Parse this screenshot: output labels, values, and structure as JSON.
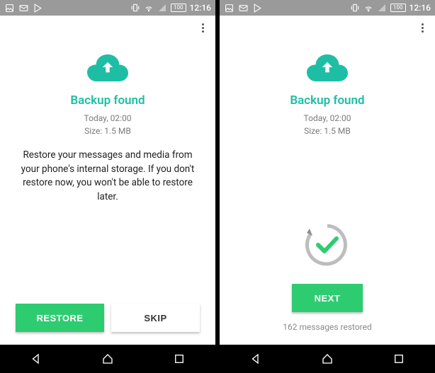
{
  "status": {
    "time": "12:16",
    "battery": "100"
  },
  "screen1": {
    "title": "Backup found",
    "timestamp": "Today, 02:00",
    "size": "Size: 1.5 MB",
    "description": "Restore your messages and media from your phone's internal storage. If you don't restore now, you won't be able to restore later.",
    "restore_label": "RESTORE",
    "skip_label": "SKIP"
  },
  "screen2": {
    "title": "Backup found",
    "timestamp": "Today, 02:00",
    "size": "Size: 1.5 MB",
    "next_label": "NEXT",
    "restored_message": "162 messages restored"
  },
  "colors": {
    "accent": "#1ebea5",
    "button_green": "#2ecc71"
  }
}
